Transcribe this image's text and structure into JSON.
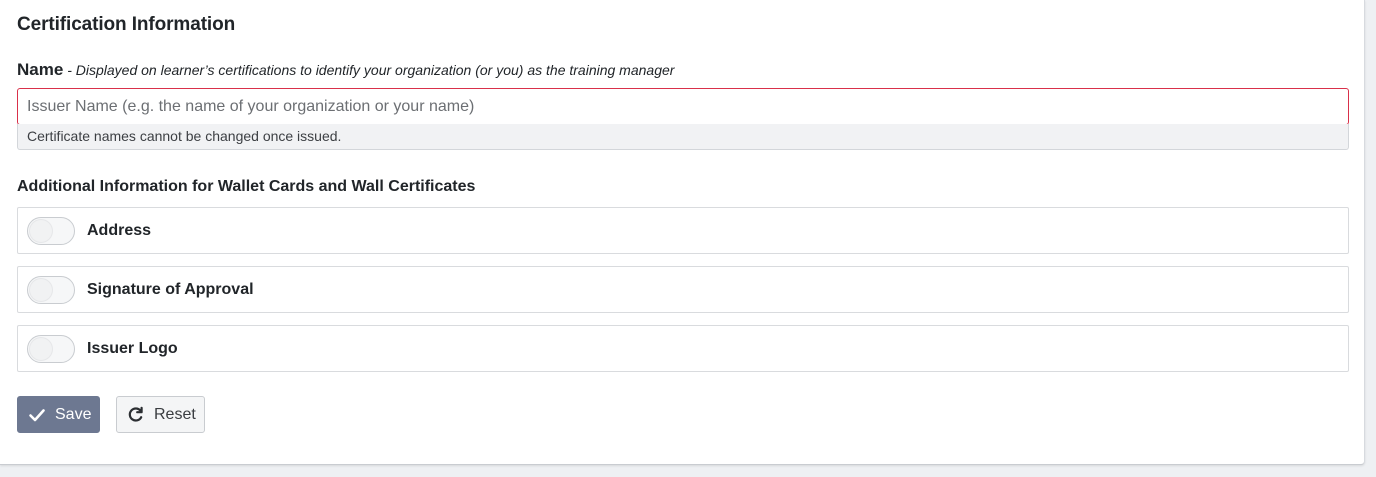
{
  "section": {
    "title": "Certification Information"
  },
  "name_field": {
    "label": "Name",
    "hint": " - Displayed on learner’s certifications to identify your organization (or you) as the training manager",
    "placeholder": "Issuer Name (e.g. the name of your organization or your name)",
    "value": "",
    "help_text": "Certificate names cannot be changed once issued.",
    "border_color": "#d9304a"
  },
  "additional": {
    "title": "Additional Information for Wallet Cards and Wall Certificates",
    "toggles": [
      {
        "label": "Address",
        "enabled": false
      },
      {
        "label": "Signature of Approval",
        "enabled": false
      },
      {
        "label": "Issuer Logo",
        "enabled": false
      }
    ]
  },
  "actions": {
    "save_label": "Save",
    "save_icon": "check-icon",
    "reset_label": "Reset",
    "reset_icon": "refresh-icon",
    "save_color": "#6d7891"
  }
}
